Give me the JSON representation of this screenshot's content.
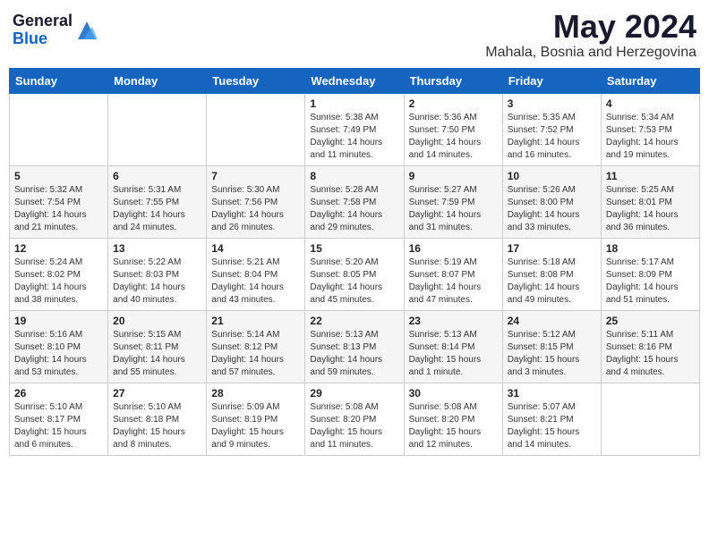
{
  "header": {
    "logo_general": "General",
    "logo_blue": "Blue",
    "month": "May 2024",
    "location": "Mahala, Bosnia and Herzegovina"
  },
  "weekdays": [
    "Sunday",
    "Monday",
    "Tuesday",
    "Wednesday",
    "Thursday",
    "Friday",
    "Saturday"
  ],
  "weeks": [
    [
      {
        "day": "",
        "info": ""
      },
      {
        "day": "",
        "info": ""
      },
      {
        "day": "",
        "info": ""
      },
      {
        "day": "1",
        "info": "Sunrise: 5:38 AM\nSunset: 7:49 PM\nDaylight: 14 hours\nand 11 minutes."
      },
      {
        "day": "2",
        "info": "Sunrise: 5:36 AM\nSunset: 7:50 PM\nDaylight: 14 hours\nand 14 minutes."
      },
      {
        "day": "3",
        "info": "Sunrise: 5:35 AM\nSunset: 7:52 PM\nDaylight: 14 hours\nand 16 minutes."
      },
      {
        "day": "4",
        "info": "Sunrise: 5:34 AM\nSunset: 7:53 PM\nDaylight: 14 hours\nand 19 minutes."
      }
    ],
    [
      {
        "day": "5",
        "info": "Sunrise: 5:32 AM\nSunset: 7:54 PM\nDaylight: 14 hours\nand 21 minutes."
      },
      {
        "day": "6",
        "info": "Sunrise: 5:31 AM\nSunset: 7:55 PM\nDaylight: 14 hours\nand 24 minutes."
      },
      {
        "day": "7",
        "info": "Sunrise: 5:30 AM\nSunset: 7:56 PM\nDaylight: 14 hours\nand 26 minutes."
      },
      {
        "day": "8",
        "info": "Sunrise: 5:28 AM\nSunset: 7:58 PM\nDaylight: 14 hours\nand 29 minutes."
      },
      {
        "day": "9",
        "info": "Sunrise: 5:27 AM\nSunset: 7:59 PM\nDaylight: 14 hours\nand 31 minutes."
      },
      {
        "day": "10",
        "info": "Sunrise: 5:26 AM\nSunset: 8:00 PM\nDaylight: 14 hours\nand 33 minutes."
      },
      {
        "day": "11",
        "info": "Sunrise: 5:25 AM\nSunset: 8:01 PM\nDaylight: 14 hours\nand 36 minutes."
      }
    ],
    [
      {
        "day": "12",
        "info": "Sunrise: 5:24 AM\nSunset: 8:02 PM\nDaylight: 14 hours\nand 38 minutes."
      },
      {
        "day": "13",
        "info": "Sunrise: 5:22 AM\nSunset: 8:03 PM\nDaylight: 14 hours\nand 40 minutes."
      },
      {
        "day": "14",
        "info": "Sunrise: 5:21 AM\nSunset: 8:04 PM\nDaylight: 14 hours\nand 43 minutes."
      },
      {
        "day": "15",
        "info": "Sunrise: 5:20 AM\nSunset: 8:05 PM\nDaylight: 14 hours\nand 45 minutes."
      },
      {
        "day": "16",
        "info": "Sunrise: 5:19 AM\nSunset: 8:07 PM\nDaylight: 14 hours\nand 47 minutes."
      },
      {
        "day": "17",
        "info": "Sunrise: 5:18 AM\nSunset: 8:08 PM\nDaylight: 14 hours\nand 49 minutes."
      },
      {
        "day": "18",
        "info": "Sunrise: 5:17 AM\nSunset: 8:09 PM\nDaylight: 14 hours\nand 51 minutes."
      }
    ],
    [
      {
        "day": "19",
        "info": "Sunrise: 5:16 AM\nSunset: 8:10 PM\nDaylight: 14 hours\nand 53 minutes."
      },
      {
        "day": "20",
        "info": "Sunrise: 5:15 AM\nSunset: 8:11 PM\nDaylight: 14 hours\nand 55 minutes."
      },
      {
        "day": "21",
        "info": "Sunrise: 5:14 AM\nSunset: 8:12 PM\nDaylight: 14 hours\nand 57 minutes."
      },
      {
        "day": "22",
        "info": "Sunrise: 5:13 AM\nSunset: 8:13 PM\nDaylight: 14 hours\nand 59 minutes."
      },
      {
        "day": "23",
        "info": "Sunrise: 5:13 AM\nSunset: 8:14 PM\nDaylight: 15 hours\nand 1 minute."
      },
      {
        "day": "24",
        "info": "Sunrise: 5:12 AM\nSunset: 8:15 PM\nDaylight: 15 hours\nand 3 minutes."
      },
      {
        "day": "25",
        "info": "Sunrise: 5:11 AM\nSunset: 8:16 PM\nDaylight: 15 hours\nand 4 minutes."
      }
    ],
    [
      {
        "day": "26",
        "info": "Sunrise: 5:10 AM\nSunset: 8:17 PM\nDaylight: 15 hours\nand 6 minutes."
      },
      {
        "day": "27",
        "info": "Sunrise: 5:10 AM\nSunset: 8:18 PM\nDaylight: 15 hours\nand 8 minutes."
      },
      {
        "day": "28",
        "info": "Sunrise: 5:09 AM\nSunset: 8:19 PM\nDaylight: 15 hours\nand 9 minutes."
      },
      {
        "day": "29",
        "info": "Sunrise: 5:08 AM\nSunset: 8:20 PM\nDaylight: 15 hours\nand 11 minutes."
      },
      {
        "day": "30",
        "info": "Sunrise: 5:08 AM\nSunset: 8:20 PM\nDaylight: 15 hours\nand 12 minutes."
      },
      {
        "day": "31",
        "info": "Sunrise: 5:07 AM\nSunset: 8:21 PM\nDaylight: 15 hours\nand 14 minutes."
      },
      {
        "day": "",
        "info": ""
      }
    ]
  ]
}
